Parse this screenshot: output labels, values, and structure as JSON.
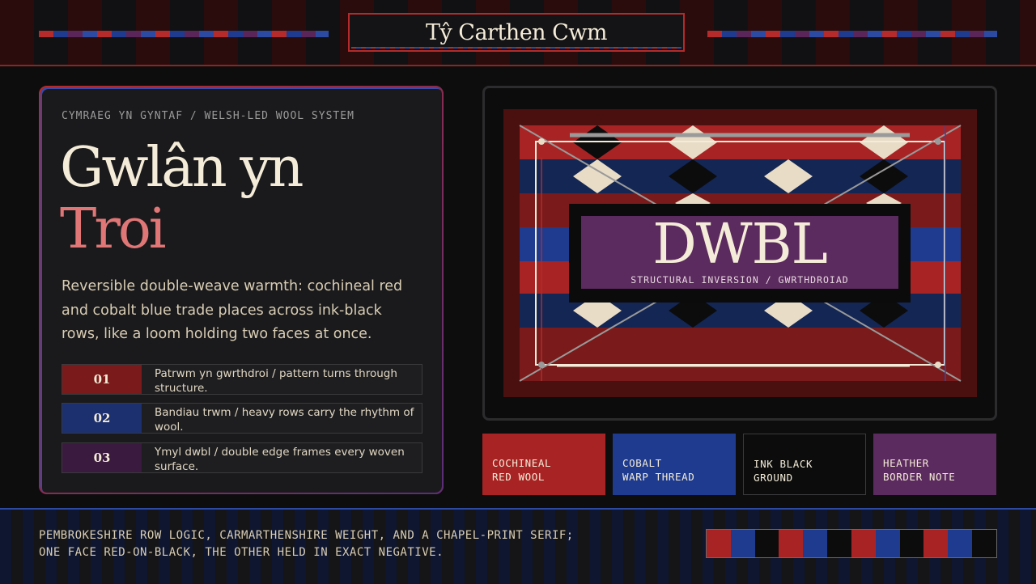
{
  "header": {
    "brand": "Tŷ Carthen Cwm"
  },
  "hero": {
    "eyebrow": "CYMRAEG YN GYNTAF / WELSH-LED WOOL SYSTEM",
    "title_line1": "Gwlân yn",
    "title_line2": "Troi",
    "lede": "Reversible double-weave warmth: cochineal red and cobalt blue trade places across ink-black rows, like a loom holding two faces at once.",
    "items": [
      {
        "num": "01",
        "text": "Patrwm yn gwrthdroi / pattern turns through structure."
      },
      {
        "num": "02",
        "text": "Bandiau trwm / heavy rows carry the rhythm of wool."
      },
      {
        "num": "03",
        "text": "Ymyl dwbl / double edge frames every woven surface."
      }
    ]
  },
  "artwork": {
    "title": "DWBL",
    "subtitle": "STRUCTURAL INVERSION / GWRTHDROIAD"
  },
  "swatches": [
    {
      "line1": "COCHINEAL",
      "line2": "RED WOOL",
      "color": "#a82424"
    },
    {
      "line1": "COBALT",
      "line2": "WARP THREAD",
      "color": "#1e3b8f"
    },
    {
      "line1": "INK BLACK",
      "line2": "GROUND",
      "color": "#0c0c0d"
    },
    {
      "line1": "HEATHER",
      "line2": "BORDER NOTE",
      "color": "#5b2a5e"
    }
  ],
  "footer": {
    "line1": "PEMBROKESHIRE ROW LOGIC, CARMARTHENSHIRE WEIGHT, AND A CHAPEL-PRINT SERIF;",
    "line2": "ONE FACE RED-ON-BLACK, THE OTHER HELD IN EXACT NEGATIVE."
  },
  "palette": {
    "red": "#a82424",
    "blue": "#1e3b8f",
    "black": "#0c0c0d",
    "heather": "#5b2a5e",
    "cream": "#f4ecd8",
    "dark_red": "#7a1a1a"
  },
  "chip_strip": [
    "#a82424",
    "#1e3b8f",
    "#0c0c0d",
    "#a82424",
    "#1e3b8f",
    "#0c0c0d",
    "#a82424",
    "#1e3b8f",
    "#0c0c0d",
    "#a82424",
    "#1e3b8f",
    "#0c0c0d"
  ]
}
